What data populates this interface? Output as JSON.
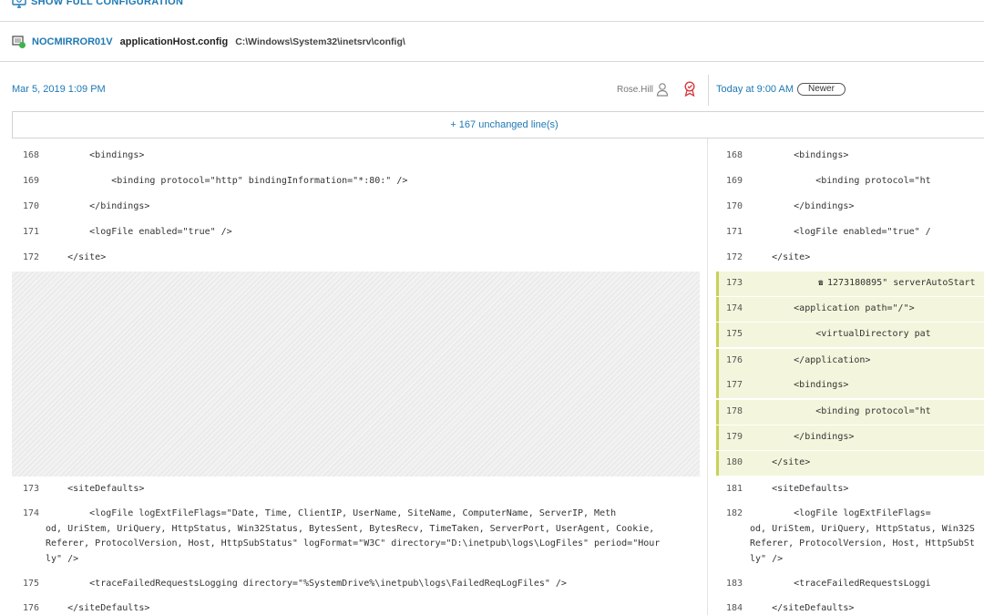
{
  "toolbar": {
    "show_full_label": "SHOW FULL CONFIGURATION"
  },
  "file": {
    "server": "NOCMIRROR01V",
    "name": "applicationHost.config",
    "path": "C:\\Windows\\System32\\inetsrv\\config\\"
  },
  "compare": {
    "left_date": "Mar 5, 2019 1:09 PM",
    "user": "Rose.Hill",
    "right_date": "Today at 9:00 AM",
    "newer_label": "Newer",
    "unchanged_label": "+ 167 unchanged line(s)"
  },
  "colors": {
    "link": "#1e78b4",
    "added_bg": "#f3f6dc",
    "added_bar": "#c8d15a",
    "award": "#d9363e",
    "online": "#3cb44b"
  },
  "left_lines": [
    {
      "num": "168",
      "text": "        <bindings>"
    },
    {
      "num": "169",
      "text": "            <binding protocol=\"http\" bindingInformation=\"*:80:\" />"
    },
    {
      "num": "170",
      "text": "        </bindings>"
    },
    {
      "num": "171",
      "text": "        <logFile enabled=\"true\" />"
    },
    {
      "num": "172",
      "text": "    </site>"
    },
    {
      "num": "173",
      "text": "    <siteDefaults>"
    },
    {
      "num": "174",
      "text": "        <logFile logExtFileFlags=\"Date, Time, ClientIP, UserName, SiteName, ComputerName, ServerIP, Meth",
      "cont": [
        "od, UriStem, UriQuery, HttpStatus, Win32Status, BytesSent, BytesRecv, TimeTaken, ServerPort, UserAgent, Cookie,",
        "Referer, ProtocolVersion, Host, HttpSubStatus\" logFormat=\"W3C\" directory=\"D:\\inetpub\\logs\\LogFiles\" period=\"Hour",
        "ly\" />"
      ]
    },
    {
      "num": "175",
      "text": "        <traceFailedRequestsLogging directory=\"%SystemDrive%\\inetpub\\logs\\FailedReqLogFiles\" />"
    },
    {
      "num": "176",
      "text": "    </siteDefaults>"
    }
  ],
  "right_lines": [
    {
      "num": "168",
      "text": "        <bindings>"
    },
    {
      "num": "169",
      "text": "            <binding protocol=\"ht"
    },
    {
      "num": "170",
      "text": "        </bindings>"
    },
    {
      "num": "171",
      "text": "        <logFile enabled=\"true\" /"
    },
    {
      "num": "172",
      "text": "    </site>"
    },
    {
      "num": "173",
      "text": "1273180895\" serverAutoStart",
      "phone": true
    },
    {
      "num": "174",
      "text": "        <application path=\"/\">"
    },
    {
      "num": "175",
      "text": "            <virtualDirectory pat"
    },
    {
      "num": "176",
      "text": "        </application>"
    },
    {
      "num": "177",
      "text": "        <bindings>"
    },
    {
      "num": "178",
      "text": "            <binding protocol=\"ht"
    },
    {
      "num": "179",
      "text": "        </bindings>"
    },
    {
      "num": "180",
      "text": "    </site>"
    },
    {
      "num": "181",
      "text": "    <siteDefaults>"
    },
    {
      "num": "182",
      "text": "        <logFile logExtFileFlags=",
      "cont": [
        "od, UriStem, UriQuery, HttpStatus, Win32S",
        "Referer, ProtocolVersion, Host, HttpSubSt",
        "ly\" />"
      ]
    },
    {
      "num": "183",
      "text": "        <traceFailedRequestsLoggi"
    },
    {
      "num": "184",
      "text": "    </siteDefaults>"
    }
  ]
}
